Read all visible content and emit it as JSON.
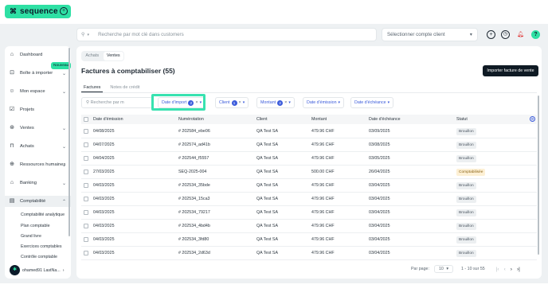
{
  "brand": {
    "name": "sequence"
  },
  "topbar": {
    "search_placeholder": "Recherche par mot clé dans customers",
    "account_placeholder": "Sélectionner compte client",
    "icons": [
      "plus-circle-icon",
      "clock-icon",
      "bell-icon",
      "help-icon"
    ]
  },
  "sidebar": {
    "new_badge": "Nouveau",
    "items": [
      {
        "label": "Dashboard",
        "icon": "home-icon"
      },
      {
        "label": "Boîte à importer",
        "icon": "inbox-icon"
      },
      {
        "label": "Mon espace",
        "icon": "user-icon"
      },
      {
        "label": "Projets",
        "icon": "check-square-icon"
      },
      {
        "label": "Ventes",
        "icon": "tag-icon"
      },
      {
        "label": "Achats",
        "icon": "bag-icon"
      },
      {
        "label": "Ressources humaines",
        "icon": "globe-icon"
      },
      {
        "label": "Banking",
        "icon": "bank-icon"
      },
      {
        "label": "Comptabilité",
        "icon": "ledger-icon"
      }
    ],
    "subitems": [
      "Comptabilité analytique",
      "Plan comptable",
      "Grand livre",
      "Exercices comptables",
      "Contrôle comptable"
    ],
    "user": {
      "name": "ohamed91 LastNa..."
    }
  },
  "main": {
    "segment": [
      "Achats",
      "Ventes"
    ],
    "title": "Factures à comptabiliser (55)",
    "import_button": "Importer facture de vente",
    "subtabs": [
      "Factures",
      "Notes de crédit"
    ],
    "filter_search": "Recherche par m",
    "filters": [
      {
        "label": "Date d'import",
        "count": "2"
      },
      {
        "label": "Client",
        "count": "1"
      },
      {
        "label": "Montant",
        "count": "2"
      },
      {
        "label": "Date d'émission",
        "count": ""
      },
      {
        "label": "Date d'échéance",
        "count": ""
      }
    ],
    "columns": [
      "Date d'émission",
      "Numérotation",
      "Client",
      "Montant",
      "Date d'échéance",
      "Statut"
    ],
    "rows": [
      [
        "04/08/2025",
        "# 202584_ebe06",
        "QA Test SA",
        "479.96 CHF",
        "03/09/2025",
        "Brouillon"
      ],
      [
        "04/07/2025",
        "# 202574_ad41b",
        "QA Test SA",
        "479.96 CHF",
        "03/08/2025",
        "Brouillon"
      ],
      [
        "04/04/2025",
        "# 202544_f5557",
        "QA Test SA",
        "479.96 CHF",
        "03/05/2025",
        "Brouillon"
      ],
      [
        "27/03/2025",
        "SEQ-2025-004",
        "QA Test SA",
        "500.00 CHF",
        "26/04/2025",
        "Comptabilisée"
      ],
      [
        "04/03/2025",
        "# 202534_35bde",
        "QA Test SA",
        "479.96 CHF",
        "03/04/2025",
        "Brouillon"
      ],
      [
        "04/03/2025",
        "# 202534_15ca3",
        "QA Test SA",
        "479.96 CHF",
        "03/04/2025",
        "Brouillon"
      ],
      [
        "04/03/2025",
        "# 202534_79217",
        "QA Test SA",
        "479.96 CHF",
        "03/04/2025",
        "Brouillon"
      ],
      [
        "04/03/2025",
        "# 202534_4bd4b",
        "QA Test SA",
        "479.96 CHF",
        "03/04/2025",
        "Brouillon"
      ],
      [
        "04/03/2025",
        "# 202534_3fd80",
        "QA Test SA",
        "479.96 CHF",
        "03/04/2025",
        "Brouillon"
      ],
      [
        "04/03/2025",
        "# 202534_2d63d",
        "QA Test SA",
        "479.96 CHF",
        "03/04/2025",
        "Brouillon"
      ]
    ],
    "pager": {
      "label": "Par page:",
      "per_page": "10",
      "range": "1 - 10 sur 55"
    }
  }
}
